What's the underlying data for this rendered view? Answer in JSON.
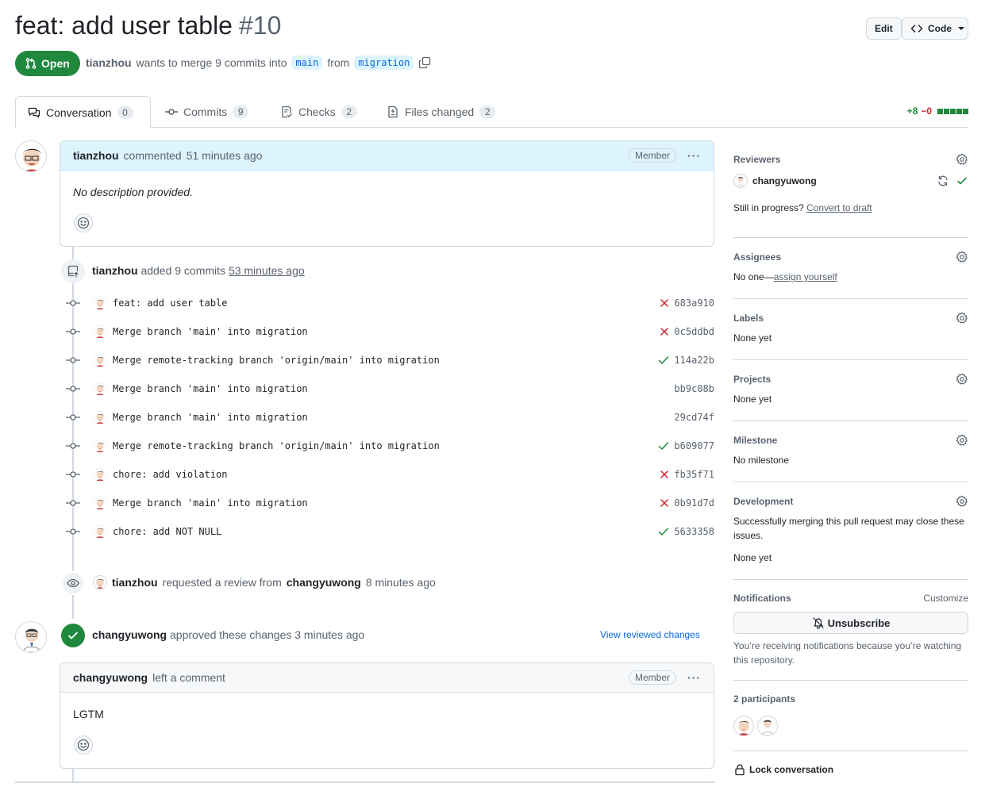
{
  "pr": {
    "title": "feat: add user table",
    "number": "#10",
    "state": "Open",
    "author": "tianzhou",
    "merge_text_1": "wants to merge 9 commits into",
    "base_branch": "main",
    "merge_text_2": "from",
    "head_branch": "migration"
  },
  "header_buttons": {
    "edit": "Edit",
    "code": "Code"
  },
  "tabs": [
    {
      "label": "Conversation",
      "count": "0"
    },
    {
      "label": "Commits",
      "count": "9"
    },
    {
      "label": "Checks",
      "count": "2"
    },
    {
      "label": "Files changed",
      "count": "2"
    }
  ],
  "diffstat": {
    "added": "+8",
    "removed": "−0"
  },
  "first_comment": {
    "author": "tianzhou",
    "action": "commented",
    "time": "51 minutes ago",
    "badge": "Member",
    "body": "No description provided."
  },
  "commits_event": {
    "author": "tianzhou",
    "action": "added 9 commits",
    "time": "53 minutes ago"
  },
  "commits": [
    {
      "message": "feat: add user table",
      "sha": "683a910",
      "status": "fail"
    },
    {
      "message": "Merge branch 'main' into migration",
      "sha": "0c5ddbd",
      "status": "fail"
    },
    {
      "message": "Merge remote-tracking branch 'origin/main' into migration",
      "sha": "114a22b",
      "status": "pass"
    },
    {
      "message": "Merge branch 'main' into migration",
      "sha": "bb9c08b",
      "status": "none"
    },
    {
      "message": "Merge branch 'main' into migration",
      "sha": "29cd74f",
      "status": "none"
    },
    {
      "message": "Merge remote-tracking branch 'origin/main' into migration",
      "sha": "b609077",
      "status": "pass"
    },
    {
      "message": "chore: add violation",
      "sha": "fb35f71",
      "status": "fail"
    },
    {
      "message": "Merge branch 'main' into migration",
      "sha": "0b91d7d",
      "status": "fail"
    },
    {
      "message": "chore: add NOT NULL",
      "sha": "5633358",
      "status": "pass"
    }
  ],
  "review_request": {
    "author": "tianzhou",
    "action": "requested a review from",
    "reviewer": "changyuwong",
    "time": "8 minutes ago"
  },
  "approval": {
    "author": "changyuwong",
    "action": "approved these changes",
    "time": "3 minutes ago",
    "link": "View reviewed changes"
  },
  "review_comment": {
    "author": "changyuwong",
    "action": "left a comment",
    "badge": "Member",
    "body": "LGTM"
  },
  "sidebar": {
    "reviewers": {
      "title": "Reviewers",
      "name": "changyuwong",
      "draft_prefix": "Still in progress?",
      "draft_link": "Convert to draft"
    },
    "assignees": {
      "title": "Assignees",
      "prefix": "No one—",
      "link": "assign yourself"
    },
    "labels": {
      "title": "Labels",
      "value": "None yet"
    },
    "projects": {
      "title": "Projects",
      "value": "None yet"
    },
    "milestone": {
      "title": "Milestone",
      "value": "No milestone"
    },
    "development": {
      "title": "Development",
      "desc": "Successfully merging this pull request may close these issues.",
      "value": "None yet"
    },
    "notifications": {
      "title": "Notifications",
      "customize": "Customize",
      "button": "Unsubscribe",
      "desc": "You’re receiving notifications because you’re watching this repository."
    },
    "participants": {
      "title": "2 participants"
    },
    "lock": "Lock conversation"
  },
  "colors": {
    "green": "#1f883d",
    "red": "#cf222e",
    "blue": "#0969da",
    "muted": "#59636e",
    "header_blue": "#ddf4ff"
  }
}
